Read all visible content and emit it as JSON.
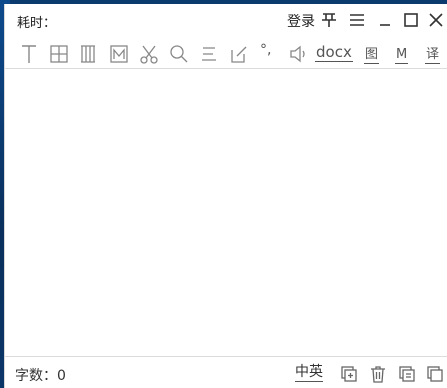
{
  "window": {
    "title": "耗时：",
    "login_label": "登录",
    "pin_label": "𐊰"
  },
  "toolbar": {
    "docx_label": "docx",
    "image_label": "图",
    "markdown_label": "M",
    "translate_label": "译",
    "degree_label": "°,"
  },
  "status": {
    "word_count": "字数：0",
    "language": "中英"
  },
  "editor": {
    "value": ""
  },
  "colors": {
    "icon": "#777777",
    "text": "#222222",
    "divider": "#dcdcdc"
  }
}
